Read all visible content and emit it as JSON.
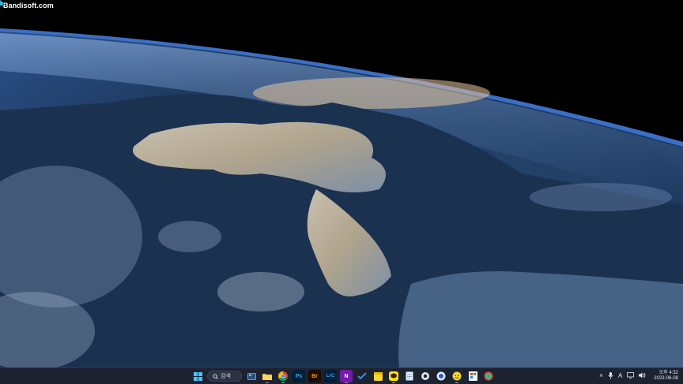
{
  "watermark": "Bandisoft.com",
  "wallpaper": {
    "description_icon": "earth-from-orbit-icon"
  },
  "taskbar": {
    "search_label": "검색",
    "pinned_icons": [
      "windows-start-icon",
      "search-icon",
      "task-view-icon",
      "file-explorer-icon",
      "chrome-icon",
      "photoshop-icon",
      "bridge-icon",
      "lightroom-classic-icon",
      "onenote-icon",
      "todo-check-icon",
      "sticky-notes-icon",
      "kakaotalk-icon",
      "notepad-icon",
      "settings-icon",
      "bandicam-icon",
      "smiley-app-icon",
      "paint-icon",
      "color-picker-icon"
    ],
    "photoshop_label": "Ps",
    "bridge_label": "Br",
    "lightroom_label": "LrC",
    "tray": {
      "ime_label": "A",
      "time_period": "오후",
      "time": "4:32",
      "date": "2023-06-08"
    }
  },
  "colors": {
    "taskbar_bg": "#1c2230",
    "ocean": "#1d3658",
    "atmosphere": "#3b6fc7"
  }
}
